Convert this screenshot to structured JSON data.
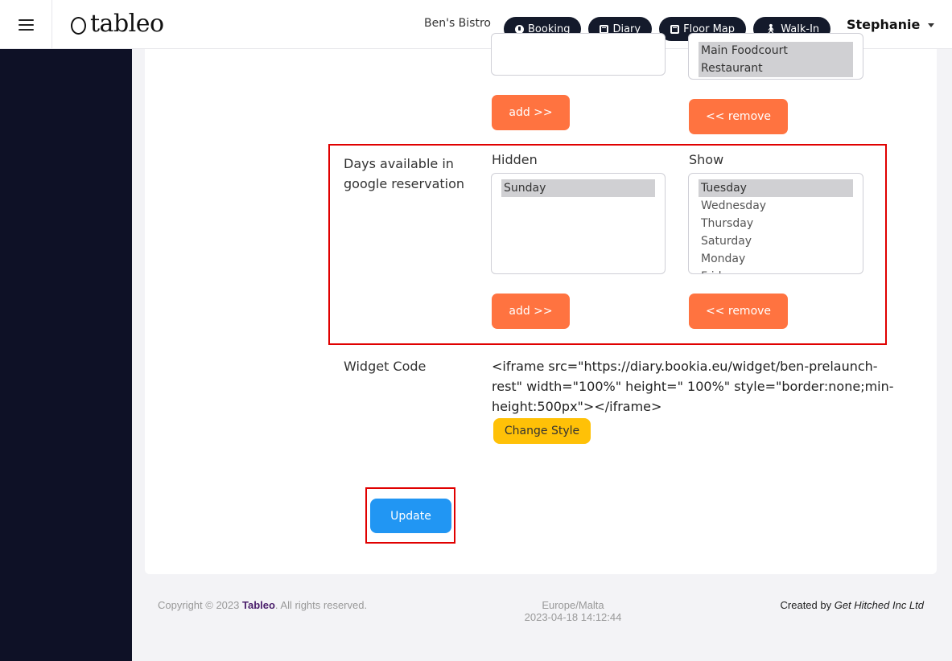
{
  "header": {
    "logo_text": "tableo",
    "venue": "Ben's Bistro",
    "nav": [
      {
        "label": "Booking",
        "icon": "circle-info-icon"
      },
      {
        "label": "Diary",
        "icon": "calendar-icon"
      },
      {
        "label": "Floor Map",
        "icon": "calendar-icon"
      },
      {
        "label": "Walk-In",
        "icon": "walking-person-icon"
      }
    ],
    "user": "Stephanie"
  },
  "upper_section": {
    "right_list": [
      "Main Foodcourt",
      "Restaurant"
    ],
    "add_label": "add >>",
    "remove_label": "<< remove"
  },
  "days_section": {
    "label_line1": "Days available in",
    "label_line2": "google reservation",
    "hidden_heading": "Hidden",
    "show_heading": "Show",
    "hidden_options": [
      "Sunday"
    ],
    "show_options": [
      "Tuesday",
      "Wednesday",
      "Thursday",
      "Saturday",
      "Monday",
      "Friday"
    ],
    "add_label": "add >>",
    "remove_label": "<< remove"
  },
  "widget": {
    "label": "Widget Code",
    "code_line1": "<iframe src=\"https://diary.bookia.eu/widget/ben-prelaunch-",
    "code_line2": "rest\" width=\"100%\" height=\" 100%\" style=\"border:none;min-",
    "code_line3": "height:500px\"></iframe>",
    "change_style_label": "Change Style"
  },
  "update_label": "Update",
  "footer": {
    "copyright_prefix": "Copyright © 2023 ",
    "brand": "Tableo",
    "copyright_suffix": ". All rights reserved.",
    "timezone": "Europe/Malta",
    "datetime": "2023-04-18 14:12:44",
    "created_by_prefix": "Created by ",
    "created_by_name": "Get Hitched Inc Ltd"
  },
  "colors": {
    "accent_orange": "#ff7340",
    "accent_blue": "#2196f3",
    "accent_yellow": "#ffc107",
    "nav_dark": "#141a2b",
    "sidebar": "#0e1126",
    "highlight_red": "#e00000"
  }
}
